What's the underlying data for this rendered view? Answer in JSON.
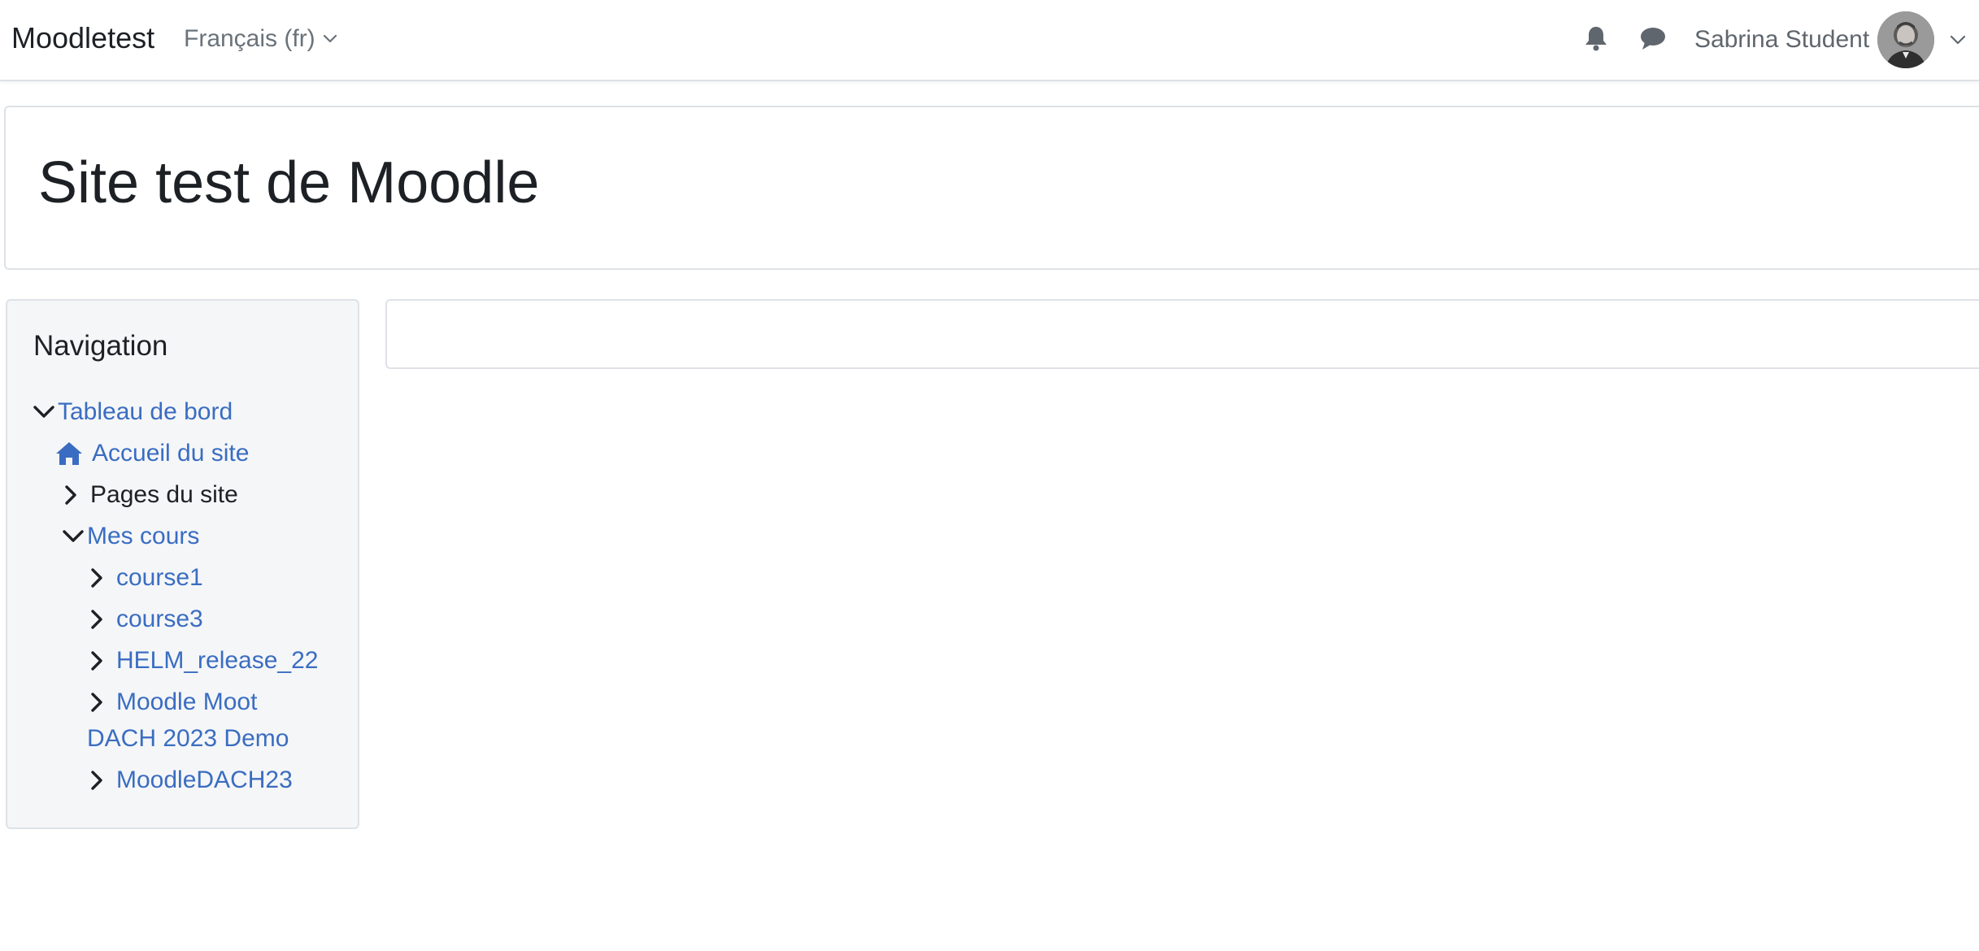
{
  "navbar": {
    "brand": "Moodletest",
    "language": "Français (fr)",
    "user_name": "Sabrina Student",
    "icons": {
      "notifications": "bell-icon",
      "messages": "chat-icon",
      "user_menu": "chevron-down-icon"
    }
  },
  "header": {
    "title": "Site test de Moodle"
  },
  "navigation": {
    "title": "Navigation",
    "items": [
      {
        "label": "Tableau de bord",
        "icon": "chevron-down-icon",
        "link": true
      },
      {
        "label": "Accueil du site",
        "icon": "home-icon",
        "link": true
      },
      {
        "label": "Pages du site",
        "icon": "chevron-right-icon",
        "link": false
      },
      {
        "label": "Mes cours",
        "icon": "chevron-down-icon",
        "link": true
      },
      {
        "label": "course1",
        "icon": "chevron-right-icon",
        "link": true
      },
      {
        "label": "course3",
        "icon": "chevron-right-icon",
        "link": true
      },
      {
        "label": "HELM_release_22",
        "icon": "chevron-right-icon",
        "link": true
      },
      {
        "label_line1": "Moodle Moot",
        "label_line2": "DACH 2023 Demo",
        "icon": "chevron-right-icon",
        "link": true
      },
      {
        "label": "MoodleDACH23",
        "icon": "chevron-right-icon",
        "link": true
      }
    ]
  },
  "colors": {
    "link": "#3a6dc1",
    "text": "#1d2125",
    "muted": "#6a737b",
    "block_bg": "#f5f6f8",
    "border": "#dee2e6"
  }
}
